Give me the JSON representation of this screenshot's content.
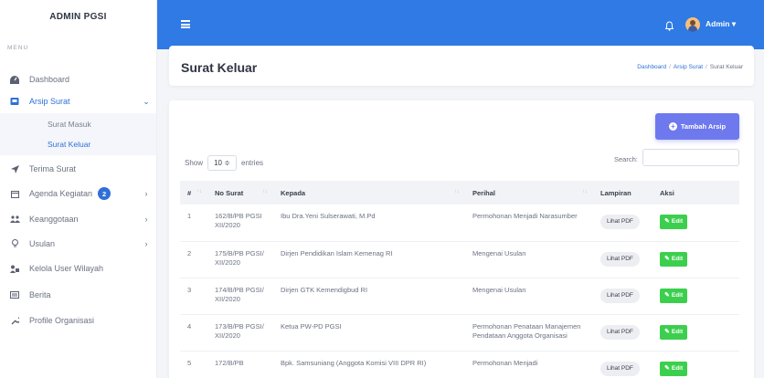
{
  "app": {
    "brand": "ADMIN PGSI"
  },
  "sidebar": {
    "caption": "MENU",
    "items": [
      {
        "label": "Dashboard",
        "icon": "dashboard-icon"
      },
      {
        "label": "Arsip Surat",
        "icon": "archive-icon",
        "chevron": "⌄"
      },
      {
        "label": "Terima Surat",
        "icon": "send-icon"
      },
      {
        "label": "Agenda Kegiatan",
        "icon": "calendar-icon",
        "badge": "2",
        "chevron": "›"
      },
      {
        "label": "Keanggotaan",
        "icon": "users-icon",
        "chevron": "›"
      },
      {
        "label": "Usulan",
        "icon": "lightbulb-icon",
        "chevron": "›"
      },
      {
        "label": "Kelola User Wilayah",
        "icon": "user-group-icon"
      },
      {
        "label": "Berita",
        "icon": "newspaper-icon"
      },
      {
        "label": "Profile Organisasi",
        "icon": "wrench-icon"
      }
    ],
    "sub_items": [
      {
        "label": "Surat Masuk"
      },
      {
        "label": "Surat Keluar"
      }
    ]
  },
  "topbar": {
    "user": "Admin",
    "caret": "▾"
  },
  "header": {
    "title": "Surat Keluar",
    "breadcrumb": [
      "Dashboard",
      "Arsip Surat",
      "Surat Keluar"
    ]
  },
  "toolbar": {
    "add_label": "Tambah Arsip",
    "show_label": "Show",
    "entries_value": "10 ≑",
    "entries_label": "entries",
    "search_label": "Search:"
  },
  "table": {
    "columns": [
      "#",
      "No Surat",
      "Kepada",
      "Perihal",
      "Lampiran",
      "Aksi"
    ],
    "rows": [
      {
        "no": "1",
        "no_surat": "162/B/PB PGSI XII/2020",
        "kepada": "Ibu Dra.Yeni Sulserawati, M.Pd",
        "perihal": "Permohonan Menjadi Narasumber",
        "lampiran": "Lihat PDF",
        "aksi": "Edit"
      },
      {
        "no": "2",
        "no_surat": "175/B/PB PGSI/ XII/2020",
        "kepada": "Dirjen Pendidikan Islam Kemenag RI",
        "perihal": "Mengenai Usulan",
        "lampiran": "Lihat PDF",
        "aksi": "Edit"
      },
      {
        "no": "3",
        "no_surat": "174/B/PB PGSI/ XII/2020",
        "kepada": "Dirjen GTK Kemendigbud RI",
        "perihal": "Mengenai Usulan",
        "lampiran": "Lihat PDF",
        "aksi": "Edit"
      },
      {
        "no": "4",
        "no_surat": "173/B/PB PGSI/ XII/2020",
        "kepada": "Ketua PW-PD PGSI",
        "perihal": "Permohonan Penataan Manajemen Pendataan Anggota Organisasi",
        "lampiran": "Lihat PDF",
        "aksi": "Edit"
      },
      {
        "no": "5",
        "no_surat": "172/B/PB",
        "kepada": "Bpk. Samsuniang (Anggota Komisi VIII DPR RI)",
        "perihal": "Permohonan Menjadi",
        "lampiran": "Lihat PDF",
        "aksi": "Edit"
      }
    ]
  },
  "colors": {
    "primary": "#2f7ae5",
    "add_button": "#6e79ee",
    "edit_button": "#3ccf4e",
    "active_link": "#2f6fd8"
  }
}
